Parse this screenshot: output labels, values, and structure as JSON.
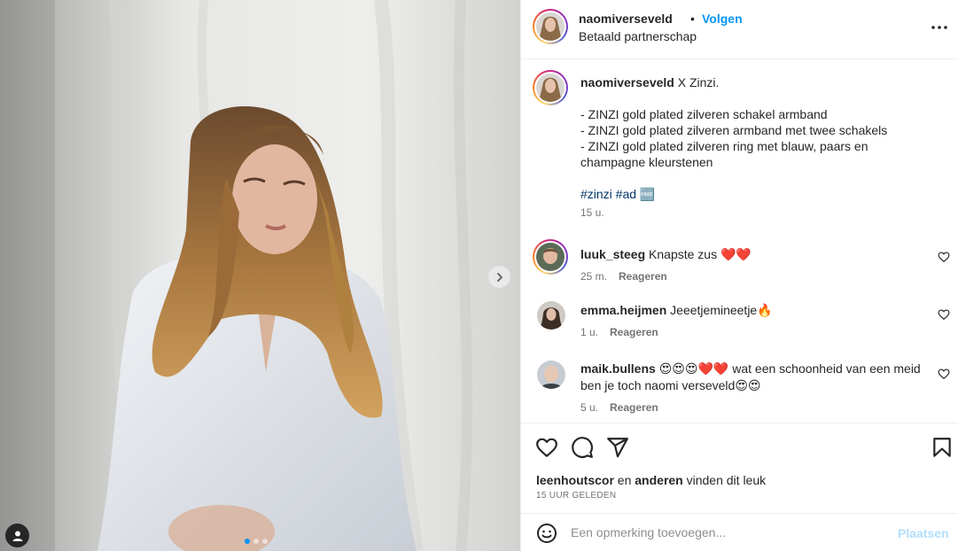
{
  "colors": {
    "accent": "#0095f6",
    "hashtag": "#00376b",
    "heart_red": "#ed4956",
    "muted": "#737373"
  },
  "header": {
    "username": "naomiverseveld",
    "separator": "•",
    "follow_label": "Volgen",
    "subtitle": "Betaald partnerschap"
  },
  "caption": {
    "username": "naomiverseveld",
    "text": "X Zinzi.",
    "lines": [
      "- ZINZI gold plated zilveren schakel armband",
      "- ZINZI gold plated zilveren armband met twee schakels",
      "- ZINZI gold plated zilveren ring met blauw, paars en champagne kleurstenen"
    ],
    "hashtags": "#zinzi #ad 🆓",
    "time": "15 u."
  },
  "comments": [
    {
      "username": "luuk_steeg",
      "text": "Knapste zus ❤️❤️",
      "time": "25 m.",
      "reply_label": "Reageren"
    },
    {
      "username": "emma.heijmen",
      "text": "Jeeetjemineetje🔥",
      "time": "1 u.",
      "reply_label": "Reageren"
    },
    {
      "username": "maik.bullens",
      "text": "😍😍😍❤️❤️ wat een schoonheid van een meid ben je toch naomi verseveld😍😍",
      "time": "5 u.",
      "reply_label": "Reageren"
    }
  ],
  "likes": {
    "user": "leenhoutscor",
    "connector": "en",
    "others": "anderen",
    "suffix": "vinden dit leuk"
  },
  "timestamp": "15 UUR GELEDEN",
  "comment_box": {
    "placeholder": "Een opmerking toevoegen...",
    "post_label": "Plaatsen"
  },
  "carousel": {
    "current": 1,
    "total": 3
  },
  "icons": {
    "more": "more-horizontal-icon",
    "next": "chevron-right-icon",
    "like": "heart-outline-icon",
    "comment": "comment-icon",
    "share": "share-icon",
    "save": "bookmark-icon",
    "emoji": "emoji-icon",
    "tag": "user-tag-icon"
  }
}
